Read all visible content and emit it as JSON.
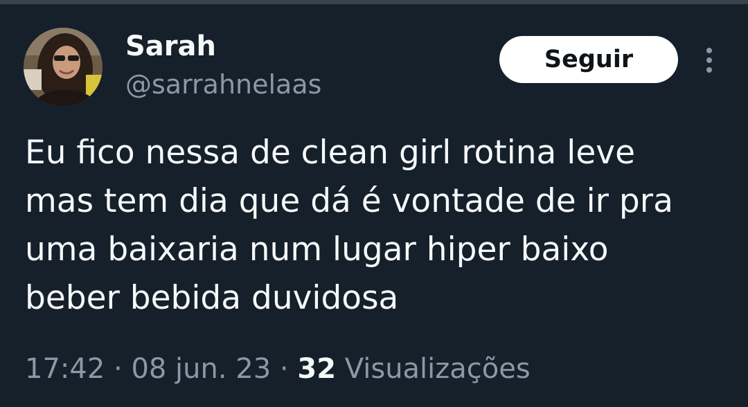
{
  "author": {
    "display_name": "Sarah",
    "handle": "@sarrahnelaas"
  },
  "actions": {
    "follow_label": "Seguir",
    "more_icon": "more-vertical-icon"
  },
  "tweet": {
    "lines": [
      "Eu fico nessa de clean girl rotina leve",
      "mas tem dia que dá é vontade de ir pra",
      "uma baixaria num lugar hiper baixo",
      "beber bebida duvidosa"
    ]
  },
  "meta": {
    "time": "17:42",
    "separator": "·",
    "date": "08 jun. 23",
    "views_count": "32",
    "views_label": "Visualizações"
  },
  "colors": {
    "background": "#15202b",
    "primary_text": "#f7f9f9",
    "secondary_text": "#8b98a5",
    "button_bg": "#ffffff",
    "button_text": "#0f1419"
  }
}
